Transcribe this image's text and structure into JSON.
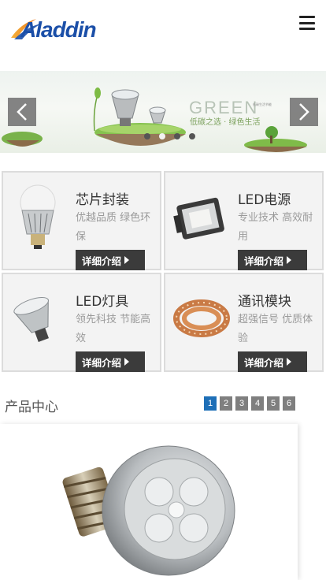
{
  "header": {
    "logo_text": "Aladdin",
    "menu_icon": "hamburger-icon"
  },
  "banner": {
    "headline": "GREEN",
    "tagline": "低碳之选 · 绿色生活",
    "tiny_text": "低碳生活节能",
    "prev_icon": "chevron-left-icon",
    "next_icon": "chevron-right-icon",
    "slides": 4,
    "active_slide": 1
  },
  "categories": [
    {
      "title": "芯片封装",
      "desc": "优越品质 绿色环保",
      "more": "详细介绍",
      "icon": "led-bulb-icon"
    },
    {
      "title": "LED电源",
      "desc": "专业技术 高效耐用",
      "more": "详细介绍",
      "icon": "floodlight-icon"
    },
    {
      "title": "LED灯具",
      "desc": "领先科技 节能高效",
      "more": "详细介绍",
      "icon": "led-spotlight-icon"
    },
    {
      "title": "通讯模块",
      "desc": "超强信号 优质体验",
      "more": "详细介绍",
      "icon": "led-strip-icon"
    }
  ],
  "products": {
    "title": "产品中心",
    "pages": [
      "1",
      "2",
      "3",
      "4",
      "5",
      "6"
    ],
    "active_page": "1"
  },
  "colors": {
    "pager_active": "#1e6fb7",
    "pager_inactive": "#7f7f7f",
    "button_dark": "#3b3b3b",
    "logo_blue": "#1b4fa8",
    "logo_orange": "#f29a1e"
  }
}
